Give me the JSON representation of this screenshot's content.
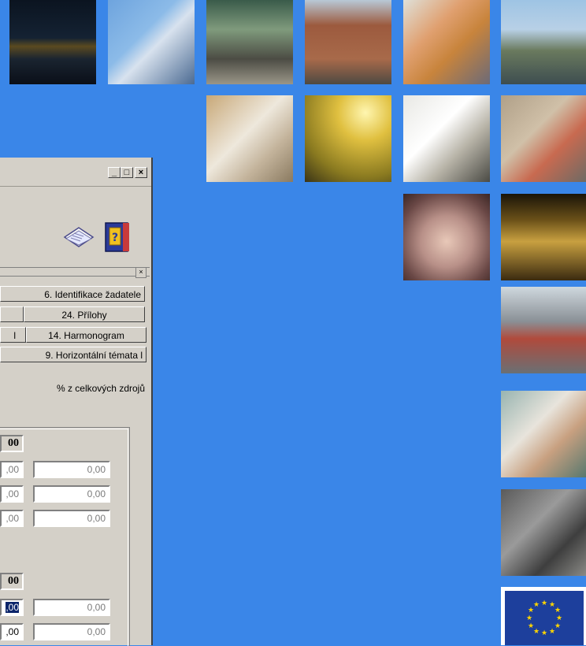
{
  "photo_tiles": [
    {
      "name": "night-castle-photo"
    },
    {
      "name": "blossom-branch-photo"
    },
    {
      "name": "mother-stroller-photo"
    },
    {
      "name": "brick-building-photo"
    },
    {
      "name": "women-computer-photo"
    },
    {
      "name": "castle-bridge-photo"
    },
    {
      "name": "lab-scientist-photo"
    },
    {
      "name": "golden-skyline-photo"
    },
    {
      "name": "flipchart-presentation-photo"
    },
    {
      "name": "students-photo"
    },
    {
      "name": "coin-stacks-photo"
    },
    {
      "name": "powder-tower-photo"
    },
    {
      "name": "construction-workers-photo"
    },
    {
      "name": "dentist-photo"
    },
    {
      "name": "wheelchair-photo"
    }
  ],
  "eu_flag": {
    "icon": "eu-flag-icon",
    "color": "#1d3f9c",
    "star_color": "#ffd500"
  },
  "window": {
    "controls": {
      "minimize": "_",
      "maximize": "□",
      "close": "×"
    },
    "toolbar_icons": [
      "open-book-icon",
      "help-book-icon"
    ],
    "subpanel_close": "×",
    "tabs_row1": {
      "tab6": "6. Identifikace žadatele"
    },
    "tabs_row2": {
      "left": "",
      "tab24": "24. Přílohy"
    },
    "tabs_row3": {
      "left": "l",
      "tab14": "14. Harmonogram"
    },
    "tabs_row4": {
      "tab19": "9. Horizontální témata l"
    },
    "column_header": "% z celkových zdrojů",
    "group1": {
      "total": "00",
      "rows": [
        {
          "value": ",00",
          "percent": "0,00"
        },
        {
          "value": ",00",
          "percent": "0,00"
        },
        {
          "value": ",00",
          "percent": "0,00"
        }
      ]
    },
    "group2": {
      "total": "00",
      "rows": [
        {
          "value": ",00",
          "percent": "0,00",
          "selected": true
        },
        {
          "value": ",00",
          "percent": "0,00"
        }
      ]
    }
  },
  "colors": {
    "desktop_bg": "#3a86e8",
    "window_bg": "#d4d0c8",
    "selection": "#0a246a"
  }
}
